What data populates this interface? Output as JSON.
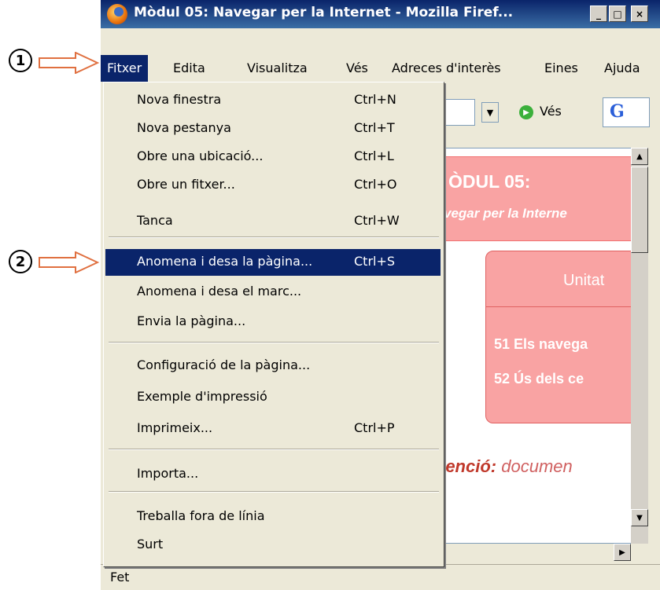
{
  "window": {
    "title": "Mòdul 05: Navegar per la Internet - Mozilla Firef...",
    "buttons": {
      "minimize": "_",
      "maximize": "□",
      "close": "×"
    }
  },
  "callouts": {
    "one": "1",
    "two": "2"
  },
  "menubar": {
    "items": [
      "Fitxer",
      "Edita",
      "Visualitza",
      "Vés",
      "Adreces d'interès",
      "Eines",
      "Ajuda"
    ]
  },
  "toolbar": {
    "go_label": "Vés"
  },
  "page": {
    "heading_1": "ÒDUL 05:",
    "heading_2": "vegar per la Interne",
    "unit_header": "Unitat",
    "line_1": "51 Els navega",
    "line_2": "52 Ús dels ce",
    "atencio_bold": "tenció:",
    "atencio_rest": " documen"
  },
  "status": {
    "text": "Fet"
  },
  "menu": {
    "items": [
      {
        "label": "Nova finestra",
        "shortcut": "Ctrl+N"
      },
      {
        "label": "Nova pestanya",
        "shortcut": "Ctrl+T"
      },
      {
        "label": "Obre una ubicació...",
        "shortcut": "Ctrl+L"
      },
      {
        "label": "Obre un fitxer...",
        "shortcut": "Ctrl+O"
      },
      {
        "label": "Tanca",
        "shortcut": "Ctrl+W"
      },
      {
        "label": "Anomena i desa la pàgina...",
        "shortcut": "Ctrl+S"
      },
      {
        "label": "Anomena i desa el marc...",
        "shortcut": ""
      },
      {
        "label": "Envia la pàgina...",
        "shortcut": ""
      },
      {
        "label": "Configuració de la pàgina...",
        "shortcut": ""
      },
      {
        "label": "Exemple d'impressió",
        "shortcut": ""
      },
      {
        "label": "Imprimeix...",
        "shortcut": "Ctrl+P"
      },
      {
        "label": "Importa...",
        "shortcut": ""
      },
      {
        "label": "Treballa fora de línia",
        "shortcut": ""
      },
      {
        "label": "Surt",
        "shortcut": ""
      }
    ],
    "highlighted_index": 5
  },
  "colors": {
    "selection": "#0a246a",
    "pink": "#f9a3a3",
    "arrow": "#e07040"
  }
}
